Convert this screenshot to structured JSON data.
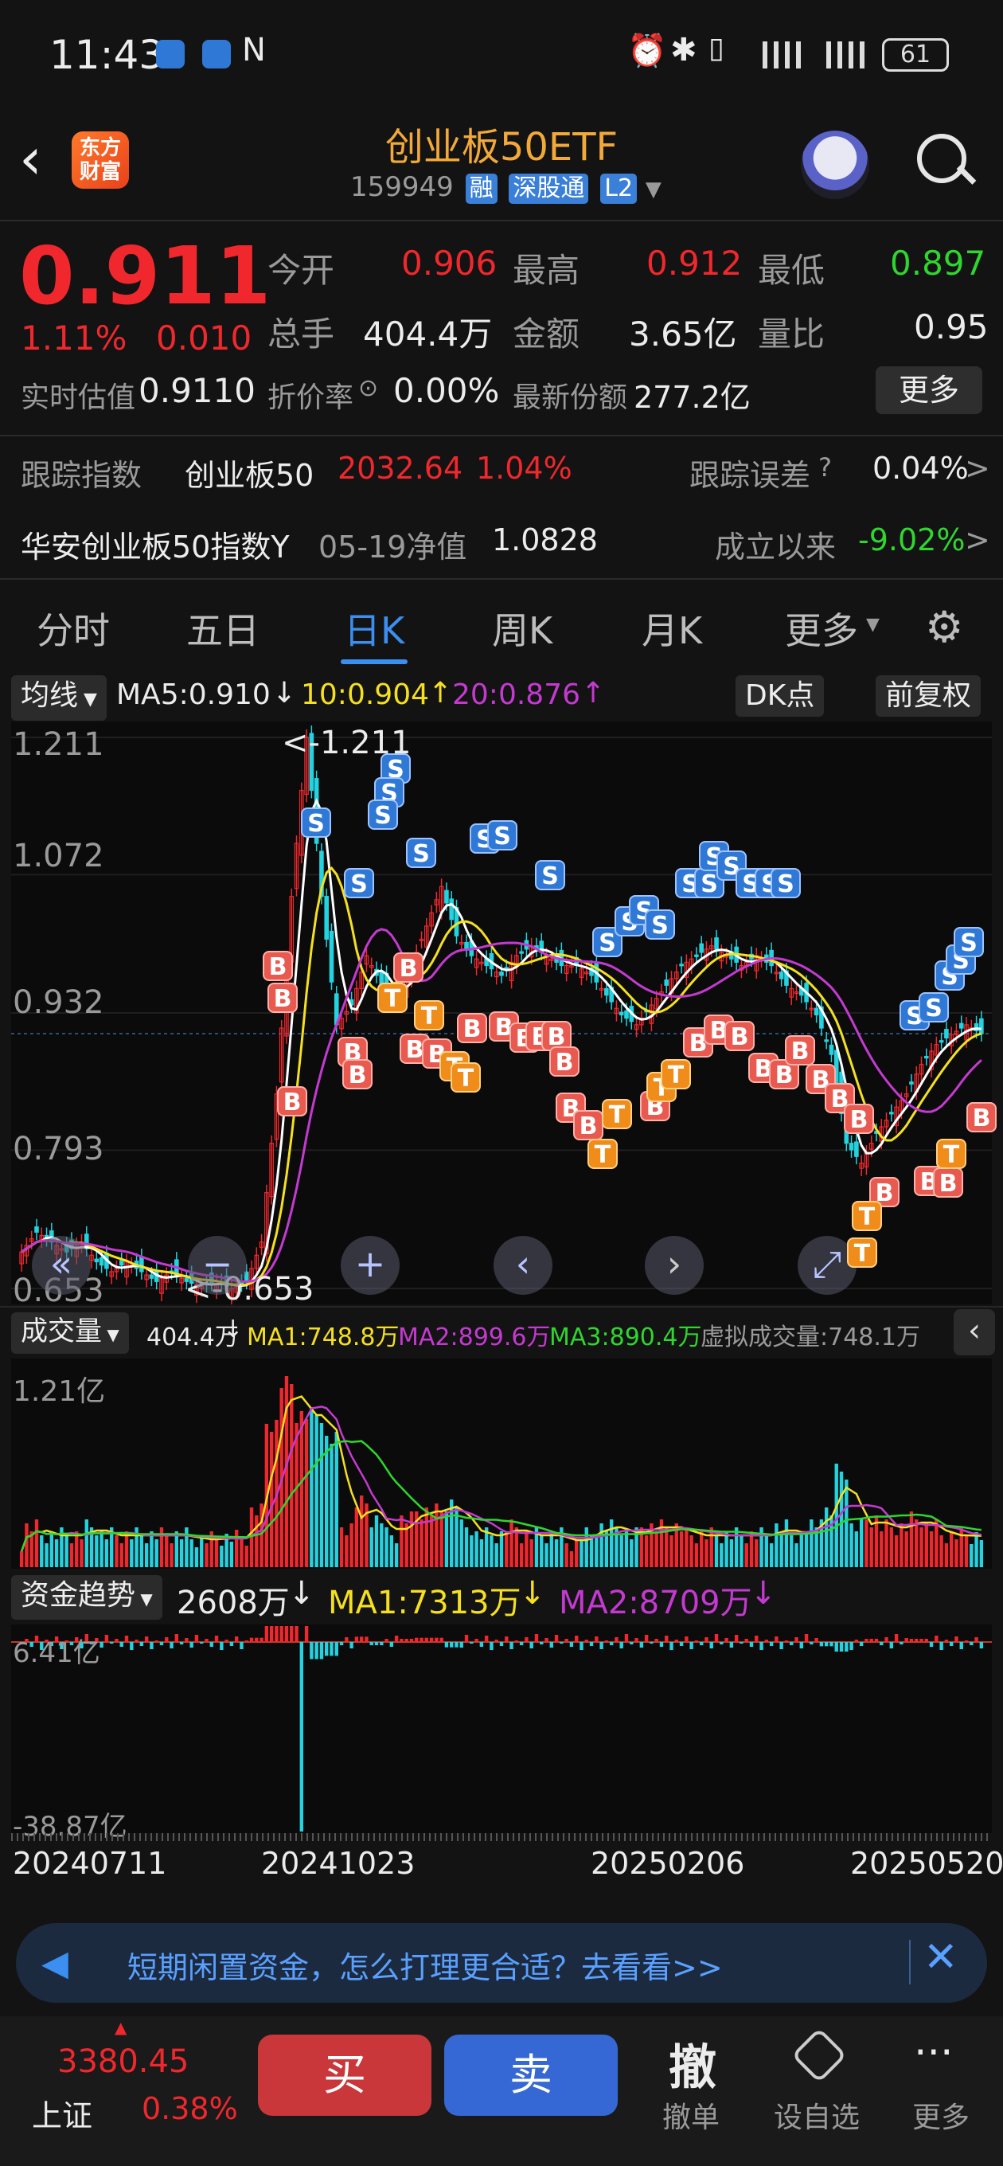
{
  "status_bar": {
    "time": "11:43",
    "battery": "61"
  },
  "header": {
    "title": "创业板50ETF",
    "code": "159949",
    "tags": [
      "融",
      "深股通",
      "L2"
    ]
  },
  "quote": {
    "price": "0.911",
    "change_pct": "1.11%",
    "change": "0.010",
    "open_label": "今开",
    "open": "0.906",
    "high_label": "最高",
    "high": "0.912",
    "low_label": "最低",
    "low": "0.897",
    "vol_label": "总手",
    "vol": "404.4万",
    "amt_label": "金额",
    "amt": "3.65亿",
    "ratio_label": "量比",
    "ratio": "0.95",
    "iopv_label": "实时估值",
    "iopv": "0.9110",
    "premium_label": "折价率",
    "premium": "0.00%",
    "shares_label": "最新份额",
    "shares": "277.2亿",
    "more_label": "更多"
  },
  "tracking": {
    "label": "跟踪指数",
    "index_name": "创业板50",
    "index_value": "2032.64",
    "index_pct": "1.04%",
    "err_label": "跟踪误差",
    "err_value": "0.04%"
  },
  "fund": {
    "name": "华安创业板50指数Y",
    "nav_label": "05-19净值",
    "nav": "1.0828",
    "since_label": "成立以来",
    "since_value": "-9.02%"
  },
  "tabs": [
    "分时",
    "五日",
    "日K",
    "周K",
    "月K",
    "更多"
  ],
  "active_tab": "日K",
  "kline": {
    "indicator": "均线",
    "ma5": "MA5:0.910",
    "ma10": "10:0.904",
    "ma20": "20:0.876",
    "dk_button": "DK点",
    "adjust_button": "前复权",
    "y_ticks": [
      "1.211",
      "1.072",
      "0.932",
      "0.793",
      "0.653"
    ],
    "max_label": "<-1.211",
    "min_label": "<-0.653"
  },
  "volume": {
    "indicator": "成交量",
    "value": "404.4万",
    "ma1": "MA1:748.8万",
    "ma2": "MA2:899.6万",
    "ma3": "MA3:890.4万",
    "virtual": "虚拟成交量:748.1万",
    "y_top": "1.21亿"
  },
  "fund_flow": {
    "indicator": "资金趋势",
    "value": "2608万",
    "ma1": "MA1:7313万",
    "ma2": "MA2:8709万",
    "y_top": "6.41亿",
    "y_bottom": "-38.87亿"
  },
  "x_dates": [
    "20240711",
    "20241023",
    "20250206",
    "20250520"
  ],
  "chart_data": {
    "type": "candlestick",
    "title": "",
    "x_ticks": [
      "20240711",
      "20241023",
      "20250206",
      "20250520"
    ],
    "ylim": [
      0.653,
      1.211
    ],
    "y_ticks": [
      1.211,
      1.072,
      0.932,
      0.793,
      0.653
    ],
    "period_high": 1.211,
    "period_low": 0.653,
    "last_close": 0.911,
    "ma": {
      "MA5": 0.91,
      "MA10": 0.904,
      "MA20": 0.876
    },
    "ma_colors": {
      "MA5": "#ffffff",
      "MA10": "#f5e020",
      "MA20": "#c43ad0"
    },
    "close_series": [
      0.69,
      0.71,
      0.7,
      0.69,
      0.7,
      0.68,
      0.67,
      0.68,
      0.67,
      0.66,
      0.67,
      0.66,
      0.655,
      0.66,
      0.653,
      0.66,
      0.7,
      0.85,
      1.05,
      1.211,
      1.05,
      0.92,
      0.94,
      0.99,
      0.96,
      0.95,
      0.98,
      1.02,
      1.06,
      1.01,
      0.99,
      0.98,
      0.97,
      0.99,
      1.0,
      0.99,
      0.98,
      0.98,
      0.97,
      0.95,
      0.93,
      0.92,
      0.94,
      0.96,
      0.98,
      0.99,
      1.0,
      0.99,
      0.98,
      0.99,
      0.98,
      0.96,
      0.95,
      0.93,
      0.89,
      0.8,
      0.78,
      0.81,
      0.83,
      0.85,
      0.88,
      0.9,
      0.91,
      0.92,
      0.911
    ]
  },
  "banner": {
    "text": "短期闲置资金，怎么打理更合适？去看看>>"
  },
  "bottom": {
    "index_value": "3380.45",
    "index_name": "上证",
    "index_pct": "0.38%",
    "buy": "买",
    "sell": "卖",
    "cancel_icon_label": "撤",
    "cancel": "撤单",
    "watch": "设自选",
    "more": "更多"
  },
  "colors": {
    "up": "#f0282d",
    "down": "#2fd62f",
    "accent": "#3a8ff0",
    "ma10": "#f5e020",
    "ma20": "#c43ad0"
  }
}
